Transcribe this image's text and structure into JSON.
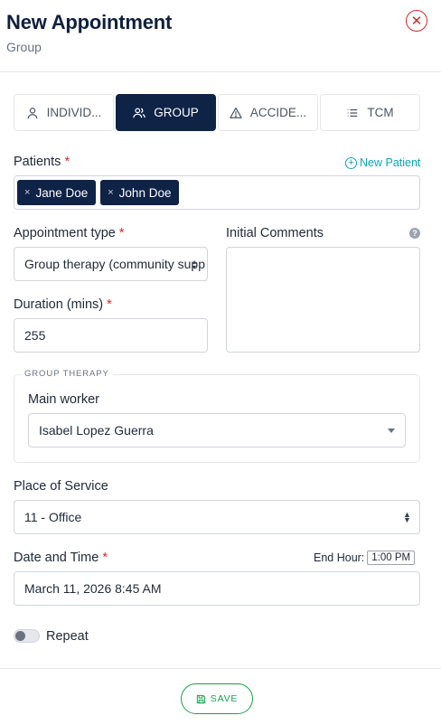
{
  "header": {
    "title": "New Appointment",
    "subtitle": "Group",
    "close_icon": "close-icon"
  },
  "tabs": [
    {
      "label": "INDIVID...",
      "icon": "person-icon",
      "active": false
    },
    {
      "label": "GROUP",
      "icon": "group-icon",
      "active": true
    },
    {
      "label": "ACCIDE...",
      "icon": "warning-icon",
      "active": false
    },
    {
      "label": "TCM",
      "icon": "list-icon",
      "active": false
    }
  ],
  "patients": {
    "label": "Patients",
    "required_mark": "*",
    "new_patient_label": "New Patient",
    "chips": [
      "Jane Doe",
      "John Doe"
    ],
    "chip_remove": "×"
  },
  "appointment_type": {
    "label": "Appointment type",
    "required_mark": "*",
    "value": "Group therapy (community supp"
  },
  "initial_comments": {
    "label": "Initial Comments",
    "help_icon": "?"
  },
  "duration": {
    "label": "Duration (mins)",
    "required_mark": "*",
    "value": "255"
  },
  "group_therapy": {
    "legend": "GROUP THERAPY",
    "main_worker_label": "Main worker",
    "main_worker_value": "Isabel Lopez Guerra"
  },
  "place_of_service": {
    "label": "Place of Service",
    "value": "11 - Office"
  },
  "date_time": {
    "label": "Date and Time",
    "required_mark": "*",
    "value": "March 11, 2026 8:45 AM",
    "end_hour_label": "End Hour:",
    "end_hour_value": "1:00 PM"
  },
  "repeat": {
    "label": "Repeat",
    "enabled": false
  },
  "save_label": "SAVE",
  "colors": {
    "primary": "#0f2347",
    "required": "#dc2626",
    "accent": "#0ea5b7",
    "save": "#16a34a"
  }
}
